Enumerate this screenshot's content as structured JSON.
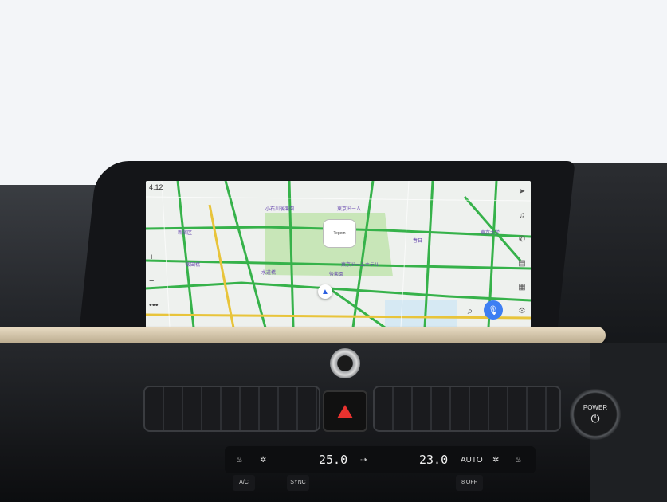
{
  "screen": {
    "status_time": "4:12",
    "dome_label": "Tegem",
    "map_labels": [
      "小石川後楽園",
      "東京ドーム",
      "東京ドームホテル",
      "水道橋",
      "後楽園",
      "春日",
      "飯田橋",
      "新宿区",
      "東京大学"
    ],
    "sidebar_icons": [
      "navigation-icon",
      "music-icon",
      "phone-icon",
      "messages-icon",
      "apps-icon",
      "settings-icon"
    ],
    "controls": {
      "zoom_in": "+",
      "zoom_out": "−",
      "more": "•••",
      "search_icon": "⌕",
      "mic_icon": "🎙"
    }
  },
  "hardware": {
    "power_label": "POWER",
    "power_symbol": "⏻",
    "climate": {
      "left_temp": "25.0",
      "right_temp": "23.0",
      "auto_label": "AUTO"
    },
    "buttons": [
      "A/C",
      "SYNC",
      "8 OFF"
    ]
  },
  "colors": {
    "road_green": "#36b24a",
    "road_yellow": "#e8c43a",
    "park": "#c8e6b8",
    "accent_blue": "#3d7ef3",
    "hazard_red": "#e8322f"
  }
}
